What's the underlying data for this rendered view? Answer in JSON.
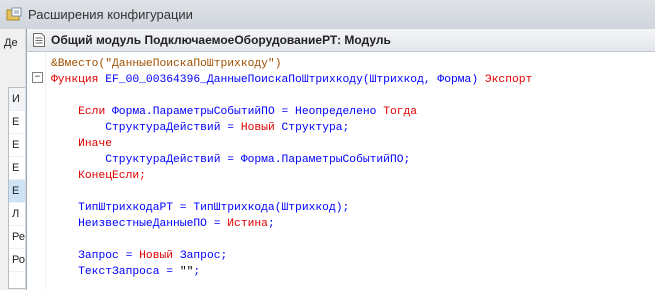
{
  "back_window": {
    "title": "Расширения конфигурации",
    "tab_label": "Де",
    "list_items": [
      "И",
      "Е",
      "Е",
      "Е",
      "Е",
      "Л",
      "Ре",
      "Ро"
    ]
  },
  "editor": {
    "title": "Общий модуль ПодключаемоеОборудованиеРТ: Модуль",
    "lines": [
      [
        {
          "t": "&Вместо(\"ДанныеПоискаПоШтрихкоду\")",
          "c": "pre"
        }
      ],
      [
        {
          "t": "Функция ",
          "c": "kw"
        },
        {
          "t": "EF_00_00364396_ДанныеПоискаПоШтрихкоду(Штрихкод, Форма) ",
          "c": "id"
        },
        {
          "t": "Экспорт",
          "c": "kw"
        }
      ],
      [],
      [
        {
          "t": "    Если ",
          "c": "kw"
        },
        {
          "t": "Форма.ПараметрыСобытийПО = Неопределено ",
          "c": "id"
        },
        {
          "t": "Тогда",
          "c": "kw"
        }
      ],
      [
        {
          "t": "        СтруктураДействий = ",
          "c": "id"
        },
        {
          "t": "Новый ",
          "c": "kw"
        },
        {
          "t": "Структура;",
          "c": "id"
        }
      ],
      [
        {
          "t": "    Иначе",
          "c": "kw"
        }
      ],
      [
        {
          "t": "        СтруктураДействий = Форма.ПараметрыСобытийПО;",
          "c": "id"
        }
      ],
      [
        {
          "t": "    КонецЕсли;",
          "c": "kw"
        }
      ],
      [],
      [
        {
          "t": "    ТипШтрихкодаРТ = ТипШтрихкода(Штрихкод);",
          "c": "id"
        }
      ],
      [
        {
          "t": "    НеизвестныеДанныеПО = ",
          "c": "id"
        },
        {
          "t": "Истина",
          "c": "kw"
        },
        {
          "t": ";",
          "c": "id"
        }
      ],
      [],
      [
        {
          "t": "    Запрос = ",
          "c": "id"
        },
        {
          "t": "Новый ",
          "c": "kw"
        },
        {
          "t": "Запрос;",
          "c": "id"
        }
      ],
      [
        {
          "t": "    ТекстЗапроса = ",
          "c": "id"
        },
        {
          "t": "\"\"",
          "c": "str"
        },
        {
          "t": ";",
          "c": "id"
        }
      ]
    ]
  }
}
